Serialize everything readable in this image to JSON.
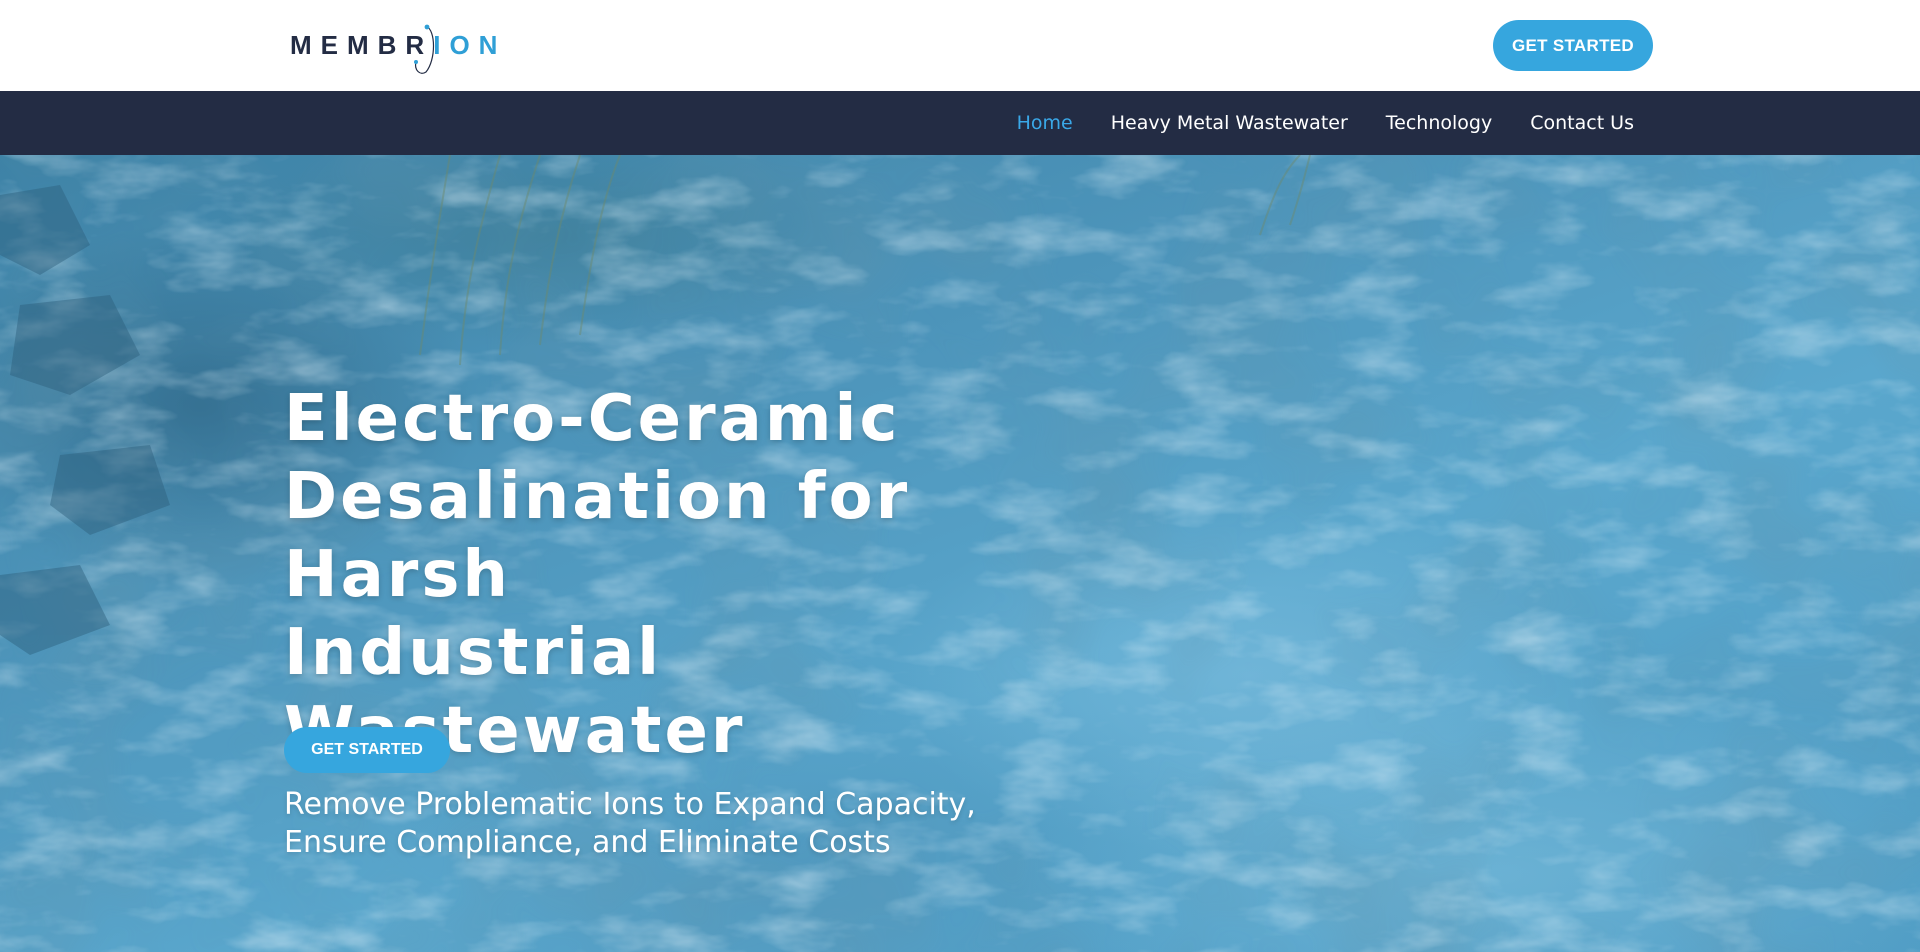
{
  "brand": {
    "logo_prefix": "MEMBR",
    "logo_accent": "ION",
    "colors": {
      "navy": "#232c44",
      "accent": "#36a6de",
      "nav_active": "#3aa8e8"
    }
  },
  "header": {
    "cta_label": "GET STARTED"
  },
  "nav": {
    "items": [
      {
        "label": "Home",
        "active": true
      },
      {
        "label": "Heavy Metal Wastewater",
        "active": false
      },
      {
        "label": "Technology",
        "active": false
      },
      {
        "label": "Contact Us",
        "active": false
      }
    ]
  },
  "hero": {
    "title_lines": [
      "Electro-Ceramic",
      "Desalination for Harsh",
      "Industrial Wastewater"
    ],
    "subtitle": "Remove Problematic Ions to Expand Capacity, Ensure Compliance, and Eliminate Costs",
    "cta_label": "GET STARTED",
    "background": "water-texture"
  }
}
